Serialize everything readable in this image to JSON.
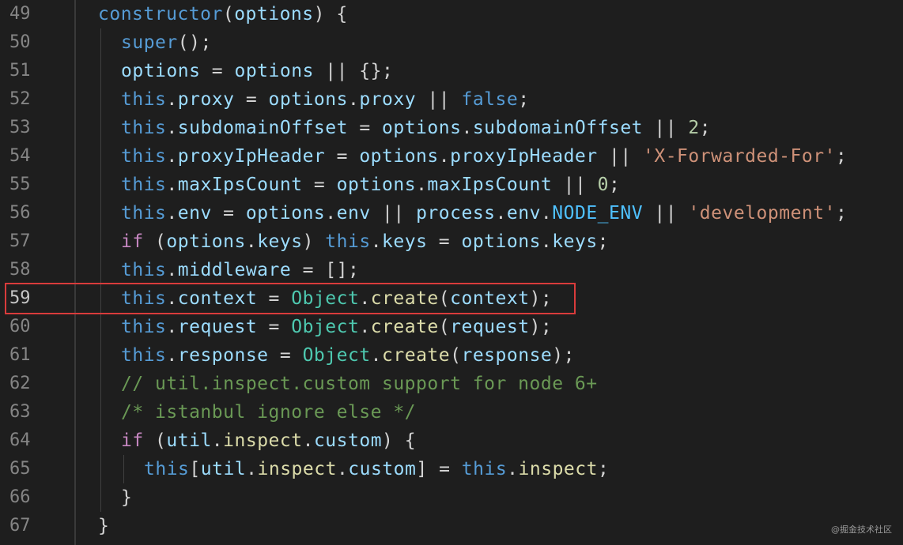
{
  "editor": {
    "highlighted_line": "59",
    "watermark": "@掘金技术社区",
    "lines": [
      {
        "num": "49",
        "tokens": [
          [
            "k-this",
            "constructor"
          ],
          [
            "op",
            "("
          ],
          [
            "var",
            "options"
          ],
          [
            "op",
            ") {"
          ]
        ]
      },
      {
        "num": "50",
        "tokens": [
          [
            "k-this",
            "super"
          ],
          [
            "op",
            "();"
          ]
        ]
      },
      {
        "num": "51",
        "tokens": [
          [
            "var",
            "options"
          ],
          [
            "op",
            " = "
          ],
          [
            "var",
            "options"
          ],
          [
            "op",
            " || {};"
          ]
        ]
      },
      {
        "num": "52",
        "tokens": [
          [
            "k-this",
            "this"
          ],
          [
            "op",
            "."
          ],
          [
            "prop",
            "proxy"
          ],
          [
            "op",
            " = "
          ],
          [
            "var",
            "options"
          ],
          [
            "op",
            "."
          ],
          [
            "prop",
            "proxy"
          ],
          [
            "op",
            " || "
          ],
          [
            "k-bool",
            "false"
          ],
          [
            "op",
            ";"
          ]
        ]
      },
      {
        "num": "53",
        "tokens": [
          [
            "k-this",
            "this"
          ],
          [
            "op",
            "."
          ],
          [
            "prop",
            "subdomainOffset"
          ],
          [
            "op",
            " = "
          ],
          [
            "var",
            "options"
          ],
          [
            "op",
            "."
          ],
          [
            "prop",
            "subdomainOffset"
          ],
          [
            "op",
            " || "
          ],
          [
            "num",
            "2"
          ],
          [
            "op",
            ";"
          ]
        ]
      },
      {
        "num": "54",
        "tokens": [
          [
            "k-this",
            "this"
          ],
          [
            "op",
            "."
          ],
          [
            "prop",
            "proxyIpHeader"
          ],
          [
            "op",
            " = "
          ],
          [
            "var",
            "options"
          ],
          [
            "op",
            "."
          ],
          [
            "prop",
            "proxyIpHeader"
          ],
          [
            "op",
            " || "
          ],
          [
            "str",
            "'X-Forwarded-For'"
          ],
          [
            "op",
            ";"
          ]
        ]
      },
      {
        "num": "55",
        "tokens": [
          [
            "k-this",
            "this"
          ],
          [
            "op",
            "."
          ],
          [
            "prop",
            "maxIpsCount"
          ],
          [
            "op",
            " = "
          ],
          [
            "var",
            "options"
          ],
          [
            "op",
            "."
          ],
          [
            "prop",
            "maxIpsCount"
          ],
          [
            "op",
            " || "
          ],
          [
            "num",
            "0"
          ],
          [
            "op",
            ";"
          ]
        ]
      },
      {
        "num": "56",
        "tokens": [
          [
            "k-this",
            "this"
          ],
          [
            "op",
            "."
          ],
          [
            "prop",
            "env"
          ],
          [
            "op",
            " = "
          ],
          [
            "var",
            "options"
          ],
          [
            "op",
            "."
          ],
          [
            "prop",
            "env"
          ],
          [
            "op",
            " || "
          ],
          [
            "var",
            "process"
          ],
          [
            "op",
            "."
          ],
          [
            "prop",
            "env"
          ],
          [
            "op",
            "."
          ],
          [
            "const",
            "NODE_ENV"
          ],
          [
            "op",
            " || "
          ],
          [
            "str",
            "'development'"
          ],
          [
            "op",
            ";"
          ]
        ]
      },
      {
        "num": "57",
        "tokens": [
          [
            "k-ctl",
            "if"
          ],
          [
            "op",
            " ("
          ],
          [
            "var",
            "options"
          ],
          [
            "op",
            "."
          ],
          [
            "prop",
            "keys"
          ],
          [
            "op",
            ") "
          ],
          [
            "k-this",
            "this"
          ],
          [
            "op",
            "."
          ],
          [
            "prop",
            "keys"
          ],
          [
            "op",
            " = "
          ],
          [
            "var",
            "options"
          ],
          [
            "op",
            "."
          ],
          [
            "prop",
            "keys"
          ],
          [
            "op",
            ";"
          ]
        ]
      },
      {
        "num": "58",
        "tokens": [
          [
            "k-this",
            "this"
          ],
          [
            "op",
            "."
          ],
          [
            "prop",
            "middleware"
          ],
          [
            "op",
            " = [];"
          ]
        ]
      },
      {
        "num": "59",
        "tokens": [
          [
            "k-this",
            "this"
          ],
          [
            "op",
            "."
          ],
          [
            "prop",
            "context"
          ],
          [
            "op",
            " = "
          ],
          [
            "cls",
            "Object"
          ],
          [
            "op",
            "."
          ],
          [
            "fn",
            "create"
          ],
          [
            "op",
            "("
          ],
          [
            "var",
            "context"
          ],
          [
            "op",
            ");"
          ]
        ]
      },
      {
        "num": "60",
        "tokens": [
          [
            "k-this",
            "this"
          ],
          [
            "op",
            "."
          ],
          [
            "prop",
            "request"
          ],
          [
            "op",
            " = "
          ],
          [
            "cls",
            "Object"
          ],
          [
            "op",
            "."
          ],
          [
            "fn",
            "create"
          ],
          [
            "op",
            "("
          ],
          [
            "var",
            "request"
          ],
          [
            "op",
            ");"
          ]
        ]
      },
      {
        "num": "61",
        "tokens": [
          [
            "k-this",
            "this"
          ],
          [
            "op",
            "."
          ],
          [
            "prop",
            "response"
          ],
          [
            "op",
            " = "
          ],
          [
            "cls",
            "Object"
          ],
          [
            "op",
            "."
          ],
          [
            "fn",
            "create"
          ],
          [
            "op",
            "("
          ],
          [
            "var",
            "response"
          ],
          [
            "op",
            ");"
          ]
        ]
      },
      {
        "num": "62",
        "tokens": [
          [
            "cmt",
            "// util.inspect.custom support for node 6+"
          ]
        ]
      },
      {
        "num": "63",
        "tokens": [
          [
            "cmt",
            "/* istanbul ignore else */"
          ]
        ]
      },
      {
        "num": "64",
        "tokens": [
          [
            "k-ctl",
            "if"
          ],
          [
            "op",
            " ("
          ],
          [
            "var",
            "util"
          ],
          [
            "op",
            "."
          ],
          [
            "fn",
            "inspect"
          ],
          [
            "op",
            "."
          ],
          [
            "prop",
            "custom"
          ],
          [
            "op",
            ") {"
          ]
        ]
      },
      {
        "num": "65",
        "tokens": [
          [
            "k-this",
            "this"
          ],
          [
            "op",
            "["
          ],
          [
            "var",
            "util"
          ],
          [
            "op",
            "."
          ],
          [
            "fn",
            "inspect"
          ],
          [
            "op",
            "."
          ],
          [
            "prop",
            "custom"
          ],
          [
            "op",
            "] = "
          ],
          [
            "k-this",
            "this"
          ],
          [
            "op",
            "."
          ],
          [
            "fn",
            "inspect"
          ],
          [
            "op",
            ";"
          ]
        ]
      },
      {
        "num": "66",
        "tokens": [
          [
            "op",
            "}"
          ]
        ]
      },
      {
        "num": "67",
        "tokens": [
          [
            "op",
            "}"
          ]
        ]
      }
    ]
  }
}
